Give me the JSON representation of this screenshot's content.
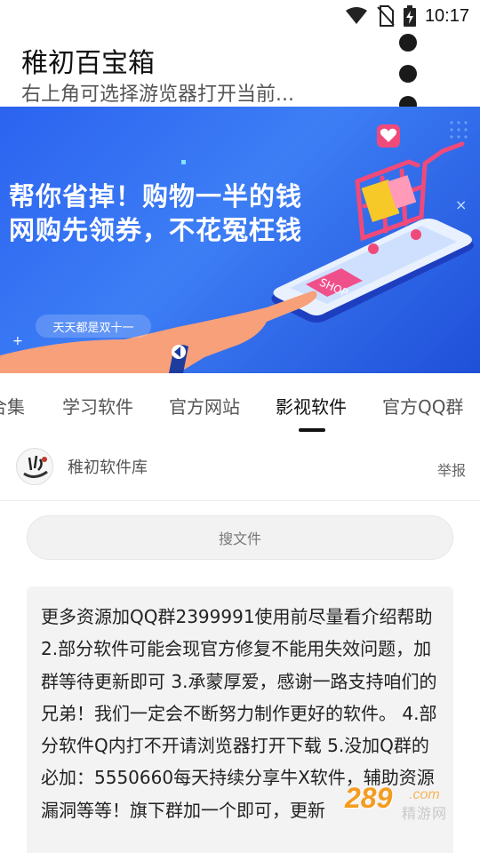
{
  "status_bar": {
    "time": "10:17"
  },
  "header": {
    "title": "稚初百宝箱",
    "subtitle": "右上角可选择游览器打开当前..."
  },
  "banner": {
    "headline_1": "帮你省掉！购物一半的钱",
    "headline_2": "网购先领券，不花冤枉钱",
    "chip": "天天都是双十一",
    "shop_label": "SHOP"
  },
  "tabs": [
    {
      "label": "合集"
    },
    {
      "label": "学习软件"
    },
    {
      "label": "官方网站"
    },
    {
      "label": "影视软件",
      "active": true
    },
    {
      "label": "官方QQ群"
    }
  ],
  "author": {
    "name": "稚初软件库",
    "report": "举报"
  },
  "search": {
    "placeholder": "搜文件"
  },
  "notice": {
    "text": "更多资源加QQ群2399991使用前尽量看介绍帮助 2.部分软件可能会现官方修复不能用失效问题，加群等待更新即可 3.承蒙厚爱，感谢一路支持咱们的兄弟！我们一定会不断努力制作更好的软件。 4.部分软件Q内打不开请浏览器打开下载 5.没加Q群的必加：5550660每天持续分享牛X软件，辅助资源漏洞等等！旗下群加一个即可，更新"
  },
  "watermark": {
    "number": "289",
    "domain": ".com",
    "cn": "精游网"
  },
  "colors": {
    "banner_blue": "#2b63f0",
    "cart_pink": "#f04a7a",
    "text_dark": "#222222",
    "watermark_orange": "#f39c1f"
  }
}
